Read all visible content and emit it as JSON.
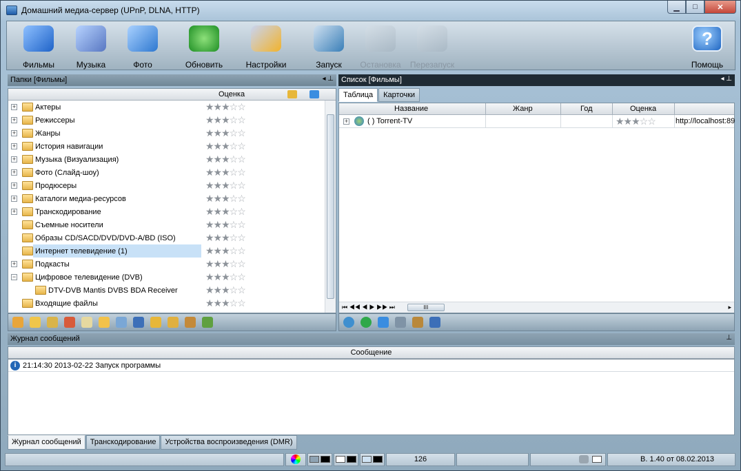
{
  "window": {
    "title": "Домашний медиа-сервер (UPnP, DLNA, HTTP)",
    "min": "▁",
    "max": "□",
    "close": "✕"
  },
  "toolbar": {
    "films": "Фильмы",
    "music": "Музыка",
    "photo": "Фото",
    "refresh": "Обновить",
    "settings": "Настройки",
    "start": "Запуск",
    "stop": "Остановка",
    "restart": "Перезапуск",
    "help": "Помощь"
  },
  "folders_panel": {
    "title": "Папки [Фильмы]",
    "col_rating": "Оценка",
    "items": [
      {
        "label": "Актеры",
        "stars": 3
      },
      {
        "label": "Режиссеры",
        "stars": 3
      },
      {
        "label": "Жанры",
        "stars": 3
      },
      {
        "label": "История навигации",
        "stars": 3
      },
      {
        "label": "Музыка (Визуализация)",
        "stars": 3
      },
      {
        "label": "Фото (Слайд-шоу)",
        "stars": 3
      },
      {
        "label": "Продюсеры",
        "stars": 3
      },
      {
        "label": "Каталоги медиа-ресурсов",
        "stars": 3
      },
      {
        "label": "Транскодирование",
        "stars": 3
      },
      {
        "label": "Съемные носители",
        "stars": 3
      },
      {
        "label": "Образы CD/SACD/DVD/DVD-A/BD (ISO)",
        "stars": 3
      },
      {
        "label": "Интернет телевидение (1)",
        "stars": 3
      },
      {
        "label": "Подкасты",
        "stars": 3
      },
      {
        "label": "Цифровое телевидение (DVB)",
        "stars": 3
      },
      {
        "label": "DTV-DVB Mantis DVBS BDA Receiver",
        "stars": 3
      },
      {
        "label": "Входящие файлы",
        "stars": 3
      }
    ]
  },
  "list_panel": {
    "title": "Список [Фильмы]",
    "tab_table": "Таблица",
    "tab_cards": "Карточки",
    "columns": {
      "name": "Название",
      "genre": "Жанр",
      "year": "Год",
      "rating": "Оценка"
    },
    "rows": [
      {
        "name": "( ) Torrent-TV",
        "genre": "",
        "year": "",
        "stars": 3,
        "url": "http://localhost:89"
      }
    ],
    "nav": "⏮ ◀◀ ◀ ▶ ▶▶ ⏭",
    "thumb_grip": "III"
  },
  "log_panel": {
    "title": "Журнал сообщений",
    "col_message": "Сообщение",
    "entries": [
      {
        "text": "21:14:30 2013-02-22 Запуск программы"
      }
    ]
  },
  "bottom_tabs": [
    "Журнал сообщений",
    "Транскодирование",
    "Устройства воспроизведения (DMR)"
  ],
  "status": {
    "count": "126",
    "version": "В. 1.40 от 08.02.2013"
  },
  "colors": {
    "dark_head": "#1f2b34",
    "selection": "#c8e1f7"
  }
}
